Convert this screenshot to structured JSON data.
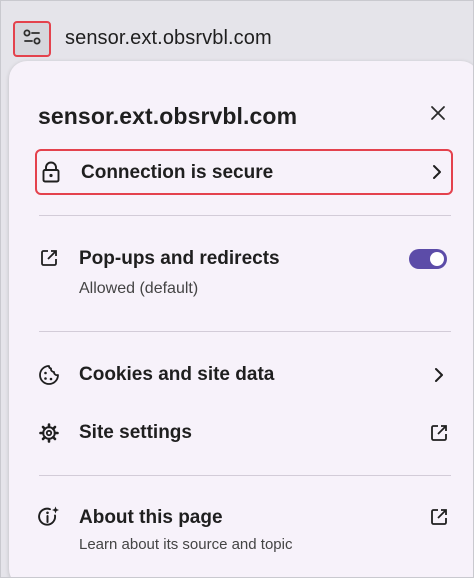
{
  "address_bar": {
    "site_info_icon": "tune-icon",
    "url": "sensor.ext.obsrvbl.com"
  },
  "panel": {
    "title": "sensor.ext.obsrvbl.com",
    "close_icon": "close-icon",
    "connection": {
      "label": "Connection is secure",
      "icon": "lock-icon",
      "trail_icon": "chevron-right-icon"
    },
    "popups": {
      "label": "Pop-ups and redirects",
      "sublabel": "Allowed (default)",
      "icon": "open-external-icon",
      "toggle_on": true,
      "toggle_color": "#5c4ca8"
    },
    "cookies": {
      "label": "Cookies and site data",
      "icon": "cookie-icon",
      "trail_icon": "chevron-right-icon"
    },
    "site_settings": {
      "label": "Site settings",
      "icon": "gear-icon",
      "trail_icon": "open-external-icon"
    },
    "about": {
      "label": "About this page",
      "sublabel": "Learn about its source and topic",
      "icon": "info-sparkle-icon",
      "trail_icon": "open-external-icon"
    }
  },
  "colors": {
    "highlight_border": "#e4424d",
    "panel_bg": "#f7f2fa",
    "toolbar_bg": "#e5e4ea"
  }
}
